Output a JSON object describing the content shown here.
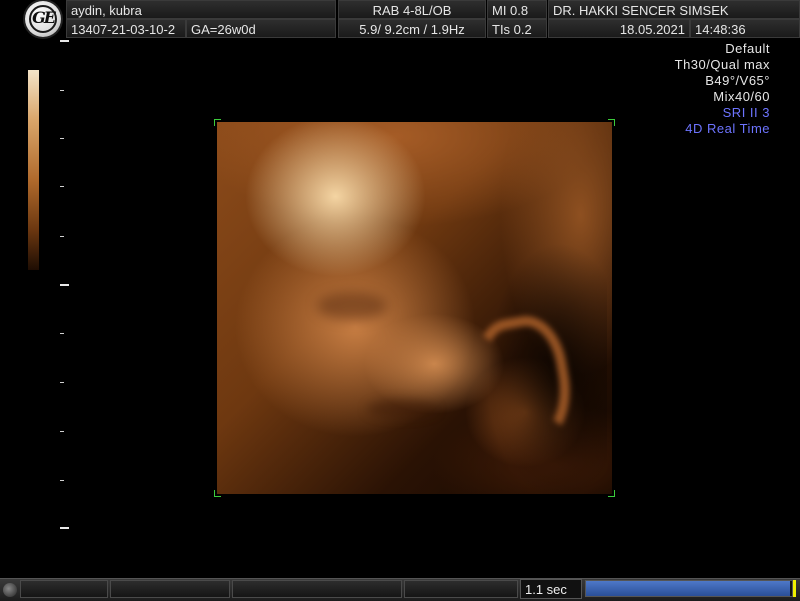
{
  "header": {
    "patient_name": "aydin, kubra",
    "patient_id": "13407-21-03-10-2",
    "ga": "GA=26w0d",
    "probe": "RAB 4-8L/OB",
    "depth_freq": "5.9/ 9.2cm / 1.9Hz",
    "mi": "MI  0.8",
    "tis": "TIs  0.2",
    "doctor": "DR. HAKKI SENCER SIMSEK",
    "date": "18.05.2021",
    "time": "14:48:36"
  },
  "logo": {
    "icon": "ge-logo-icon",
    "mark_text": "GE"
  },
  "settings": {
    "preset": "Default",
    "quality": "Th30/Qual max",
    "angles": "B49°/V65°",
    "mix": "Mix40/60",
    "sri": "SRI II 3",
    "mode": "4D Real Time"
  },
  "footer": {
    "cine_time": "1.1 sec",
    "cine_progress": 0.99
  },
  "colors": {
    "accent_blue": "#6d74ff",
    "roi_corner_green": "#3ccc3c",
    "progress_blue": "#3a64b8",
    "end_marker_yellow": "#f0f000"
  }
}
